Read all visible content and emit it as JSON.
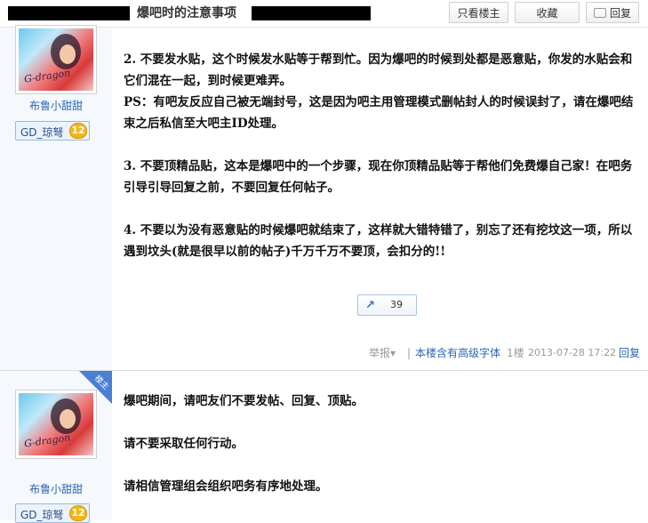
{
  "header": {
    "title": "爆吧时的注意事项",
    "buttons": {
      "only_op": "只看楼主",
      "favorite": "收藏",
      "reply": "回复"
    }
  },
  "post1": {
    "author": "布鲁小甜甜",
    "badge_label": "GD_琼弩",
    "badge_level": "12",
    "avatar_signature": "G-dragon",
    "paragraphs": [
      "2. 不要发水贴，这个时候发水贴等于帮到忙。因为爆吧的时候到处都是恶意贴，你发的水贴会和它们混在一起，到时候更难弄。",
      "PS：有吧友反应自己被无端封号，这是因为吧主用管理模式删帖封人的时候误封了，请在爆吧结束之后私信至大吧主ID处理。",
      "3. 不要顶精品贴，这本是爆吧中的一个步骤，现在你顶精品贴等于帮他们免费爆自己家！在吧务引导引导回复之前，不要回复任何帖子。",
      "4. 不要以为没有恶意贴的时候爆吧就结束了，这样就大错特错了，别忘了还有挖坟这一项，所以遇到坟头(就是很早以前的帖子)千万千万不要顶，会扣分的!!"
    ],
    "share_count": "39",
    "meta": {
      "report": "举报",
      "report_arrow": "▾",
      "separator": "|",
      "font_notice": "本楼含有高级字体",
      "floor": "1楼",
      "timestamp": "2013-07-28 17:22",
      "reply": "回复"
    }
  },
  "post2": {
    "author": "布鲁小甜甜",
    "badge_label": "GD_琼弩",
    "badge_level": "12",
    "avatar_signature": "G-dragon",
    "op_tag": "楼主",
    "paragraphs": [
      "爆吧期间，请吧友们不要发帖、回复、顶贴。",
      "请不要采取任何行动。",
      "请相信管理组会组织吧务有序地处理。"
    ]
  },
  "colors": {
    "link_blue": "#2d64b3",
    "sidebar_bg": "#f5f8fd",
    "badge_gold": "#f2b619",
    "op_tag_blue": "#4a7fd4"
  }
}
